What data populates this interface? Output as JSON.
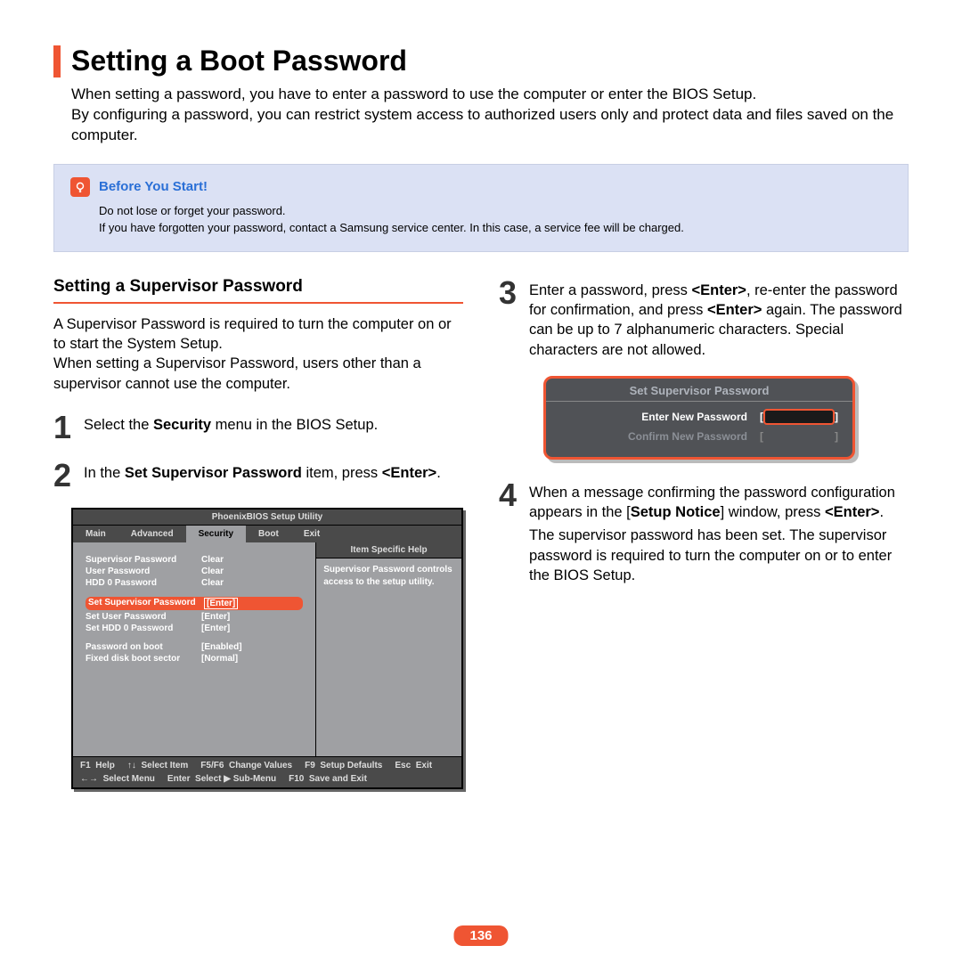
{
  "title": "Setting a Boot Password",
  "intro": "When setting a password, you have to enter a password to use the computer or enter the BIOS Setup.\nBy configuring a password, you can restrict system access to authorized users only and protect data and files saved on the computer.",
  "notice": {
    "title": "Before You Start!",
    "line1": "Do not lose or forget your password.",
    "line2": "If you have forgotten your password, contact a Samsung service center. In this case, a service fee will be charged."
  },
  "section_heading": "Setting a Supervisor Password",
  "section_para": "A Supervisor Password is required to turn the computer on or to start the System Setup.\nWhen setting a Supervisor Password, users other than a supervisor cannot use the computer.",
  "steps": {
    "s1_pre": "Select the ",
    "s1_bold": "Security",
    "s1_post": " menu in the BIOS Setup.",
    "s2_pre": "In the ",
    "s2_bold": "Set Supervisor Password",
    "s2_mid": " item, press ",
    "s2_bold2": "<Enter>",
    "s2_post": ".",
    "s3_a": "Enter a password, press ",
    "s3_b": "<Enter>",
    "s3_c": ", re-enter the password for confirmation, and press ",
    "s3_d": "<Enter>",
    "s3_e": " again. The password can be up to 7 alphanumeric characters. Special characters are not allowed.",
    "s4_a": "When a message confirming the password configuration appears in the [",
    "s4_b": "Setup Notice",
    "s4_c": "] window, press ",
    "s4_d": "<Enter>",
    "s4_e": ".",
    "s4_follow": "The supervisor password has been set. The supervisor password is required to turn the computer on or to enter the BIOS Setup."
  },
  "bios": {
    "title": "PhoenixBIOS Setup Utility",
    "tabs": [
      "Main",
      "Advanced",
      "Security",
      "Boot",
      "Exit"
    ],
    "rows": [
      {
        "label": "Supervisor Password",
        "val": "Clear"
      },
      {
        "label": "User Password",
        "val": "Clear"
      },
      {
        "label": "HDD 0 Password",
        "val": "Clear"
      }
    ],
    "rows2": [
      {
        "label": "Set Supervisor Password",
        "val": "[Enter]",
        "hl": true
      },
      {
        "label": "Set User Password",
        "val": "[Enter]"
      },
      {
        "label": "Set HDD 0 Password",
        "val": "[Enter]"
      }
    ],
    "rows3": [
      {
        "label": "Password on boot",
        "val": "[Enabled]"
      },
      {
        "label": "Fixed disk boot sector",
        "val": "[Normal]"
      }
    ],
    "help_title": "Item Specific Help",
    "help_body": "Supervisor Password controls access to the setup utility.",
    "footer": {
      "f1": "F1",
      "help": "Help",
      "arrows_v": "↑↓",
      "select_item": "Select Item",
      "f5f6": "F5/F6",
      "change_values": "Change Values",
      "f9": "F9",
      "setup_defaults": "Setup Defaults",
      "esc": "Esc",
      "exit": "Exit",
      "arrows_h": "←→",
      "select_menu": "Select Menu",
      "enter": "Enter",
      "select_sub": "Select ▶ Sub-Menu",
      "f10": "F10",
      "save_exit": "Save and Exit"
    }
  },
  "pw_dialog": {
    "title": "Set Supervisor Password",
    "row1": "Enter New Password",
    "row2": "Confirm New Password"
  },
  "page_number": "136"
}
